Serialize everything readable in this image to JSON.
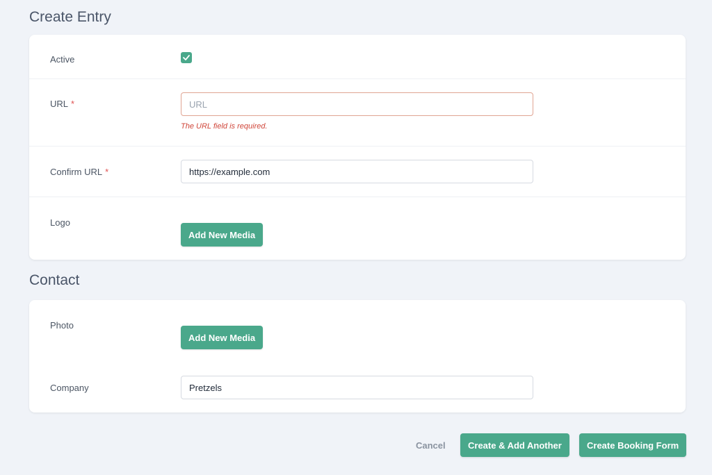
{
  "sections": {
    "entry_title": "Create Entry",
    "contact_title": "Contact"
  },
  "entry": {
    "active": {
      "label": "Active",
      "checked": true
    },
    "url": {
      "label": "URL",
      "required_mark": "*",
      "value": "",
      "placeholder": "URL",
      "error": "The URL field is required."
    },
    "confirm_url": {
      "label": "Confirm URL",
      "required_mark": "*",
      "value": "https://example.com"
    },
    "logo": {
      "label": "Logo",
      "button": "Add New Media"
    }
  },
  "contact": {
    "photo": {
      "label": "Photo",
      "button": "Add New Media"
    },
    "company": {
      "label": "Company",
      "value": "Pretzels"
    }
  },
  "footer": {
    "cancel": "Cancel",
    "create_another": "Create & Add Another",
    "create": "Create Booking Form"
  },
  "colors": {
    "accent": "#4aa88b",
    "error": "#d0473b",
    "background": "#f0f3f8"
  }
}
